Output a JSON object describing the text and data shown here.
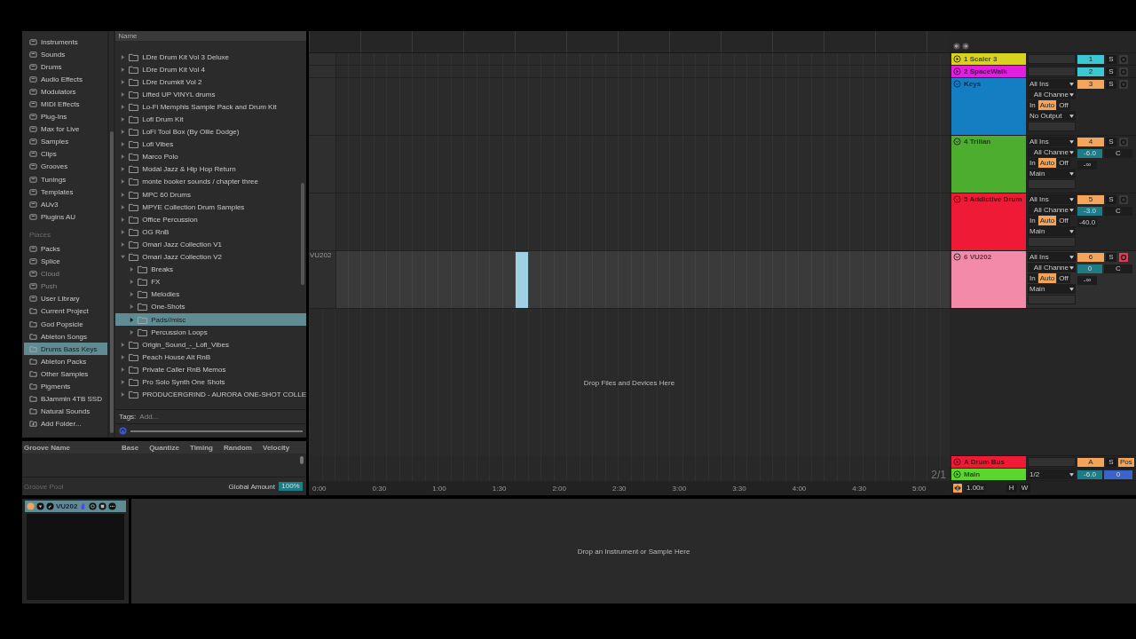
{
  "sidebar": {
    "categories": [
      {
        "label": "Instruments",
        "kind": "category",
        "selected": false,
        "disabled": false
      },
      {
        "label": "Sounds",
        "kind": "category",
        "selected": false,
        "disabled": false
      },
      {
        "label": "Drums",
        "kind": "category",
        "selected": false,
        "disabled": false
      },
      {
        "label": "Audio Effects",
        "kind": "category",
        "selected": false,
        "disabled": false
      },
      {
        "label": "Modulators",
        "kind": "category",
        "selected": false,
        "disabled": false
      },
      {
        "label": "MIDI Effects",
        "kind": "category",
        "selected": false,
        "disabled": false
      },
      {
        "label": "Plug-Ins",
        "kind": "category",
        "selected": false,
        "disabled": false
      },
      {
        "label": "Max for Live",
        "kind": "category",
        "selected": false,
        "disabled": false
      },
      {
        "label": "Samples",
        "kind": "category",
        "selected": false,
        "disabled": false
      },
      {
        "label": "Clips",
        "kind": "category",
        "selected": false,
        "disabled": false
      },
      {
        "label": "Grooves",
        "kind": "category",
        "selected": false,
        "disabled": false
      },
      {
        "label": "Tunings",
        "kind": "category",
        "selected": false,
        "disabled": false
      },
      {
        "label": "Templates",
        "kind": "category",
        "selected": false,
        "disabled": false
      },
      {
        "label": "AUv3",
        "kind": "category",
        "selected": false,
        "disabled": false
      },
      {
        "label": "Plugins AU",
        "kind": "category",
        "selected": false,
        "disabled": false
      }
    ],
    "places_title": "Places",
    "places": [
      {
        "label": "Packs",
        "kind": "category",
        "selected": false,
        "disabled": false
      },
      {
        "label": "Splice",
        "kind": "category",
        "selected": false,
        "disabled": false
      },
      {
        "label": "Cloud",
        "kind": "category",
        "selected": false,
        "disabled": true
      },
      {
        "label": "Push",
        "kind": "category",
        "selected": false,
        "disabled": true
      },
      {
        "label": "User Library",
        "kind": "category",
        "selected": false,
        "disabled": false
      },
      {
        "label": "Current Project",
        "kind": "folder",
        "selected": false,
        "disabled": false
      },
      {
        "label": "God Popsicle",
        "kind": "folder",
        "selected": false,
        "disabled": false
      },
      {
        "label": "Ableton Songs",
        "kind": "folder",
        "selected": false,
        "disabled": false
      },
      {
        "label": "Drums Bass Keys",
        "kind": "folder",
        "selected": true,
        "disabled": false
      },
      {
        "label": "Ableton Packs",
        "kind": "folder",
        "selected": false,
        "disabled": false
      },
      {
        "label": "Other Samples",
        "kind": "folder",
        "selected": false,
        "disabled": false
      },
      {
        "label": "Pigments",
        "kind": "folder",
        "selected": false,
        "disabled": false
      },
      {
        "label": "BJammin 4TB SSD",
        "kind": "folder",
        "selected": false,
        "disabled": false
      },
      {
        "label": "Natural Sounds",
        "kind": "folder",
        "selected": false,
        "disabled": false
      },
      {
        "label": "Add Folder...",
        "kind": "add",
        "selected": false,
        "disabled": false
      }
    ]
  },
  "browser": {
    "column": "Name",
    "items": [
      {
        "label": "LDre Drum Kit Vol 3 Deluxe",
        "expanded": false,
        "selected": false
      },
      {
        "label": "LDre Drum Kit Vol 4",
        "expanded": false,
        "selected": false
      },
      {
        "label": "LDre Drumkit Vol 2",
        "expanded": false,
        "selected": false
      },
      {
        "label": "Lifted UP VINYL drums",
        "expanded": false,
        "selected": false
      },
      {
        "label": "Lo-Fi Memphis Sample Pack and Drum Kit",
        "expanded": false,
        "selected": false
      },
      {
        "label": "Lofi Drum Kit",
        "expanded": false,
        "selected": false
      },
      {
        "label": "LoFi Tool Box (By Ollie Dodge)",
        "expanded": false,
        "selected": false
      },
      {
        "label": "Lofi Vibes",
        "expanded": false,
        "selected": false
      },
      {
        "label": "Marco Polo",
        "expanded": false,
        "selected": false
      },
      {
        "label": "Modal Jazz & Hip Hop Return",
        "expanded": false,
        "selected": false
      },
      {
        "label": "monte booker sounds / chapter three",
        "expanded": false,
        "selected": false
      },
      {
        "label": "MPC 60 Drums",
        "expanded": false,
        "selected": false
      },
      {
        "label": "MPYE Collection Drum Samples",
        "expanded": false,
        "selected": false
      },
      {
        "label": "Office Percussion",
        "expanded": false,
        "selected": false
      },
      {
        "label": "OG RnB",
        "expanded": false,
        "selected": false
      },
      {
        "label": "Omari Jazz Collection V1",
        "expanded": false,
        "selected": false
      },
      {
        "label": "Omari Jazz Collection V2",
        "expanded": true,
        "selected": false,
        "children": [
          {
            "label": "Breaks",
            "expanded": false,
            "selected": false
          },
          {
            "label": "FX",
            "expanded": false,
            "selected": false
          },
          {
            "label": "Melodies",
            "expanded": false,
            "selected": false
          },
          {
            "label": "One-Shots",
            "expanded": false,
            "selected": false
          },
          {
            "label": "Pads//misc",
            "expanded": false,
            "selected": true
          },
          {
            "label": "Percussion Loops",
            "expanded": false,
            "selected": false
          }
        ]
      },
      {
        "label": "Origin_Sound_-_Lofi_Vibes",
        "expanded": false,
        "selected": false
      },
      {
        "label": "Peach House Alt RnB",
        "expanded": false,
        "selected": false
      },
      {
        "label": "Private Caller RnB Memos",
        "expanded": false,
        "selected": false
      },
      {
        "label": "Pro Solo Synth One Shots",
        "expanded": false,
        "selected": false
      },
      {
        "label": "PRODUCERGRIND - AURORA ONE-SHOT COLLE",
        "expanded": false,
        "selected": false
      }
    ],
    "tags_label": "Tags:",
    "tags_placeholder": "Add..."
  },
  "groove_pool": {
    "columns": [
      "Groove Name",
      "Base",
      "Quantize",
      "Timing",
      "Random",
      "Velocity"
    ],
    "title": "Groove Pool",
    "global_amount_label": "Global Amount",
    "global_amount": {
      "text": "100%",
      "level": 1.0
    }
  },
  "tracks": [
    {
      "name": "1 Scaler 3",
      "color": "#d8d31f",
      "kind": "collapsed",
      "selected": false,
      "clip": false,
      "number": {
        "text": "1",
        "color": "#3cc8d2"
      },
      "solo": "S",
      "armed": false
    },
    {
      "name": "2 SpaceWalk",
      "color": "#e21ee0",
      "kind": "collapsed",
      "selected": false,
      "clip": false,
      "number": {
        "text": "2",
        "color": "#3cc8d2"
      },
      "solo": "S",
      "armed": false
    },
    {
      "name": "Keys",
      "color": "#137ec2",
      "kind": "expanded",
      "selected": false,
      "clip": false,
      "number": {
        "text": "3",
        "color": "#f4a55c"
      },
      "solo": "S",
      "armed": false,
      "input": "All Ins",
      "channel": "All Channe",
      "monitor": [
        {
          "label": "In",
          "selected": false
        },
        {
          "label": "Auto",
          "selected": true
        },
        {
          "label": "Off",
          "selected": false
        }
      ],
      "output": "No Output"
    },
    {
      "name": "4 Trilian",
      "color": "#4cad2f",
      "kind": "expanded",
      "selected": false,
      "clip": false,
      "number": {
        "text": "4",
        "color": "#f4a55c"
      },
      "solo": "S",
      "armed": false,
      "input": "All Ins",
      "channel": "All Channe",
      "monitor": [
        {
          "label": "In",
          "selected": false
        },
        {
          "label": "Auto",
          "selected": true
        },
        {
          "label": "Off",
          "selected": false
        }
      ],
      "output": "Main",
      "volume": "-6.0",
      "pan": "C",
      "send": "-∞"
    },
    {
      "name": "5 Addictive Drum",
      "color": "#ef1a36",
      "kind": "expanded",
      "selected": false,
      "clip": false,
      "number": {
        "text": "5",
        "color": "#f4a55c"
      },
      "solo": "S",
      "armed": false,
      "input": "All Ins",
      "channel": "All Channe",
      "monitor": [
        {
          "label": "In",
          "selected": false
        },
        {
          "label": "Auto",
          "selected": true
        },
        {
          "label": "Off",
          "selected": false
        }
      ],
      "output": "Main",
      "volume": "-3.0",
      "pan": "C",
      "send": "-40.0"
    },
    {
      "name": "6 VU202",
      "color": "#f48aaa",
      "kind": "expanded",
      "selected": true,
      "clip": true,
      "lane_label": "VU202",
      "number": {
        "text": "6",
        "color": "#f4a55c"
      },
      "solo": "S",
      "armed": true,
      "input": "All Ins",
      "channel": "All Channe",
      "monitor": [
        {
          "label": "In",
          "selected": false
        },
        {
          "label": "Auto",
          "selected": true
        },
        {
          "label": "Off",
          "selected": false
        }
      ],
      "output": "Main",
      "volume": "0",
      "pan": "C",
      "send": "-∞"
    }
  ],
  "drop_hint": "Drop Files and Devices Here",
  "returns": [
    {
      "name": "A Drum Bus",
      "color": "#ef1a36",
      "tag": "A",
      "solo": "S",
      "post": "Pos"
    },
    {
      "name": "Main",
      "color": "#5bd62c",
      "output": "1/2",
      "volume": "-6.0",
      "pan": "0",
      "signature": "2/1"
    }
  ],
  "time_ruler": [
    "0:00",
    "0:30",
    "1:00",
    "1:30",
    "2:00",
    "2:30",
    "3:00",
    "3:30",
    "4:00",
    "4:30",
    "5:00"
  ],
  "zoom": "1.00x",
  "h_button": "H",
  "w_button": "W",
  "device": {
    "name": "VU202",
    "on": true
  },
  "device_drop_hint": "Drop an Instrument or Sample Here"
}
